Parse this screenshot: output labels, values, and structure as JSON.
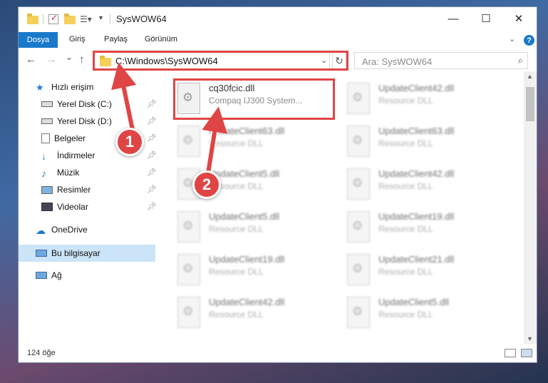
{
  "window": {
    "title": "SysWOW64",
    "minimize": "—",
    "maximize": "☐",
    "close": "✕"
  },
  "ribbon": {
    "file_tab": "Dosya",
    "tabs": [
      "Giriş",
      "Paylaş",
      "Görünüm"
    ],
    "help": "?"
  },
  "nav": {
    "back": "←",
    "forward": "→",
    "recent": "⌄",
    "up": "↑",
    "address": "C:\\Windows\\SysWOW64",
    "refresh": "↻",
    "search_placeholder": "Ara: SysWOW64"
  },
  "sidebar": {
    "items": [
      {
        "label": "Hızlı erişim",
        "icon": "star-icon"
      },
      {
        "label": "Yerel Disk (C:)",
        "icon": "drive-icon",
        "pinned": true
      },
      {
        "label": "Yerel Disk (D:)",
        "icon": "drive-icon",
        "pinned": true
      },
      {
        "label": "Belgeler",
        "icon": "document-icon",
        "pinned": true
      },
      {
        "label": "İndirmeler",
        "icon": "download-icon",
        "pinned": true
      },
      {
        "label": "Müzik",
        "icon": "music-icon",
        "pinned": true
      },
      {
        "label": "Resimler",
        "icon": "picture-icon",
        "pinned": true
      },
      {
        "label": "Videolar",
        "icon": "video-icon",
        "pinned": true
      },
      {
        "label": "OneDrive",
        "icon": "cloud-icon"
      },
      {
        "label": "Bu bilgisayar",
        "icon": "computer-icon",
        "selected": true
      },
      {
        "label": "Ağ",
        "icon": "network-icon"
      }
    ]
  },
  "files": [
    {
      "name": "cq30fcic.dll",
      "desc": "Compaq IJ300 System..."
    },
    {
      "name": "UpdateClient42.dll",
      "desc": "Resource DLL"
    },
    {
      "name": "UpdateClient63.dll",
      "desc": "Resource DLL"
    },
    {
      "name": "UpdateClient63.dll",
      "desc": "Resource DLL"
    },
    {
      "name": "UpdateClient5.dll",
      "desc": "Resource DLL"
    },
    {
      "name": "UpdateClient42.dll",
      "desc": "Resource DLL"
    },
    {
      "name": "UpdateClient5.dll",
      "desc": "Resource DLL"
    },
    {
      "name": "UpdateClient19.dll",
      "desc": "Resource DLL"
    },
    {
      "name": "UpdateClient19.dll",
      "desc": "Resource DLL"
    },
    {
      "name": "UpdateClient21.dll",
      "desc": "Resource DLL"
    },
    {
      "name": "UpdateClient42.dll",
      "desc": "Resource DLL"
    },
    {
      "name": "UpdateClient5.dll",
      "desc": "Resource DLL"
    }
  ],
  "status": {
    "count": "124 öğe"
  },
  "annotations": {
    "badge1": "1",
    "badge2": "2",
    "color": "#e04545"
  }
}
